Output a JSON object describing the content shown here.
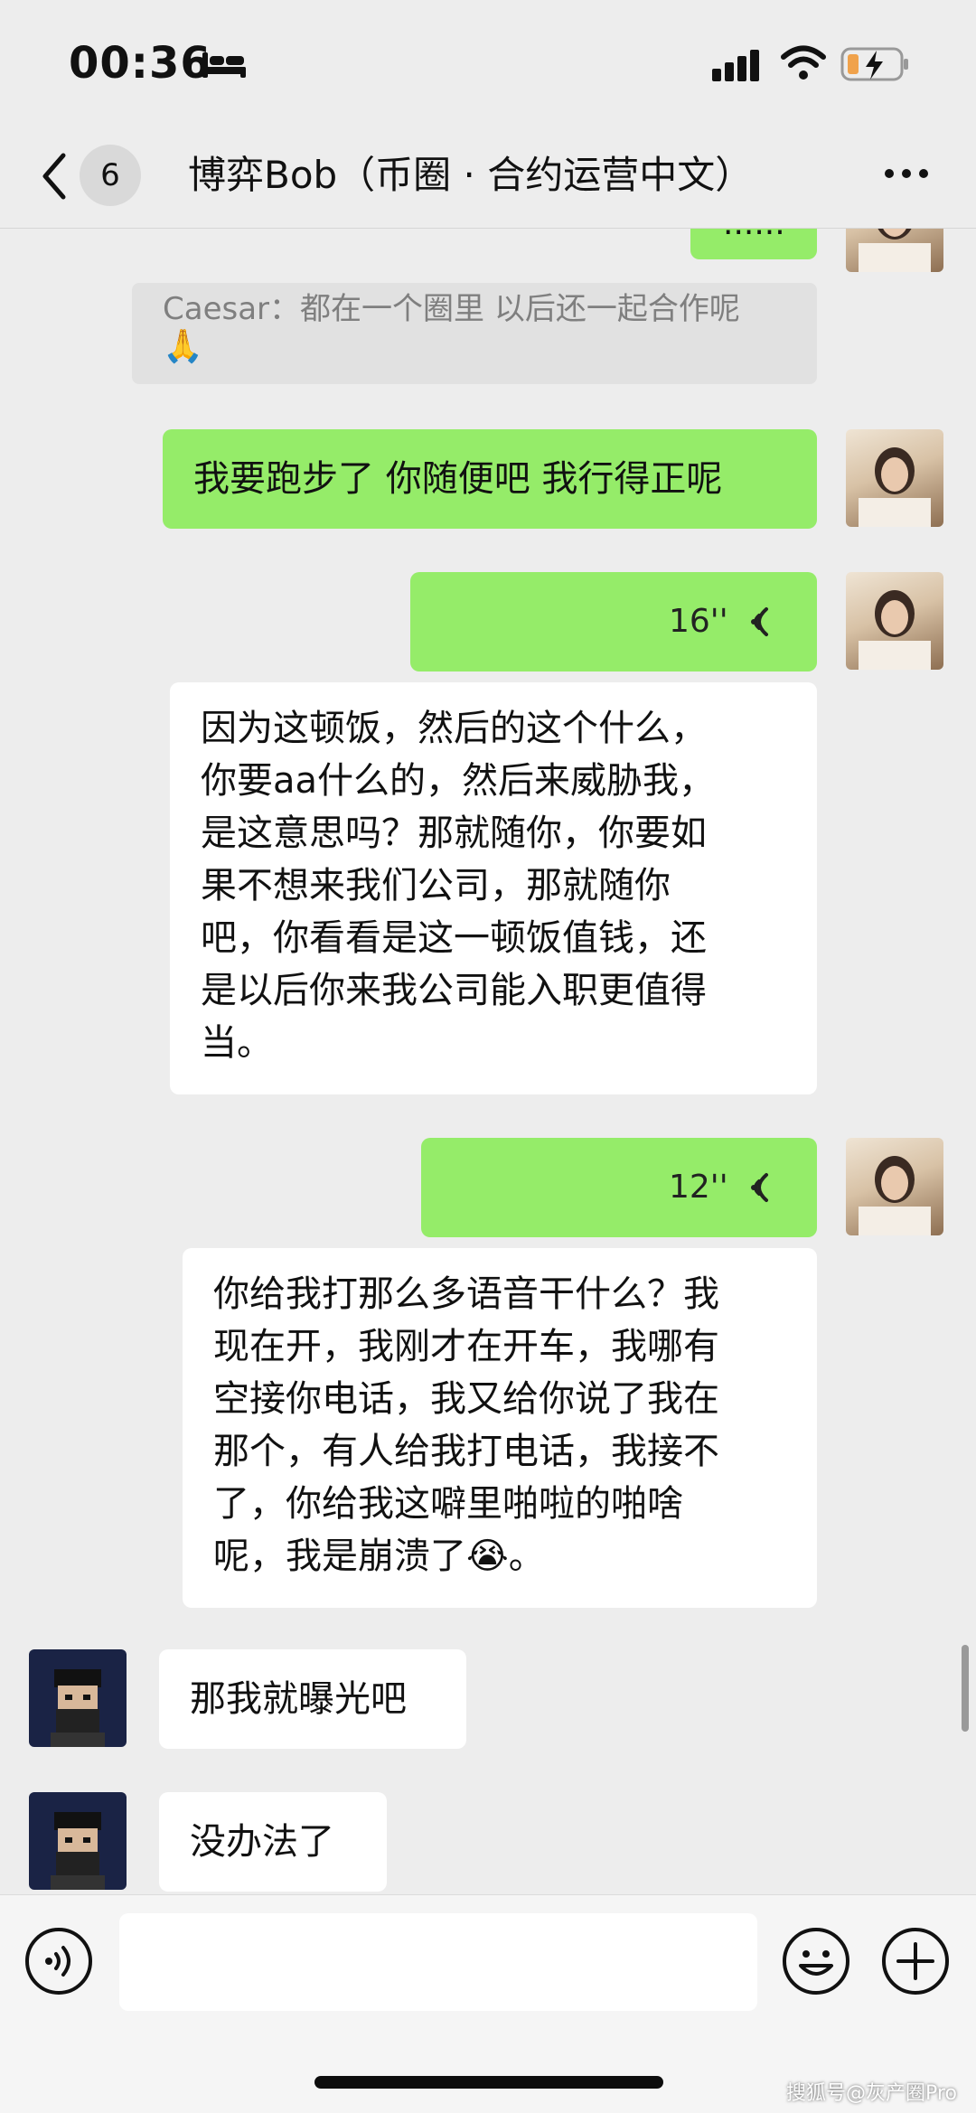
{
  "status_bar": {
    "time": "00:36",
    "sleep_icon": "bed-icon",
    "signal_icon": "cellular-signal-icon",
    "wifi_icon": "wifi-icon",
    "battery_icon": "battery-charging-icon",
    "battery_color": "#f0a24b"
  },
  "header": {
    "back_icon": "chevron-left-icon",
    "unread_count": "6",
    "title": "博弈Bob（币圈 · 合约运营中文）",
    "more_icon": "more-dots-icon"
  },
  "messages": [
    {
      "side": "right",
      "type": "text",
      "text": "......"
    },
    {
      "side": "center",
      "type": "quote",
      "text": "Caesar：都在一个圈里 以后还一起合作呢",
      "emoji": "🙏"
    },
    {
      "side": "right",
      "type": "text",
      "text": "我要跑步了 你随便吧 我行得正呢"
    },
    {
      "side": "right",
      "type": "voice",
      "duration": "16''"
    },
    {
      "side": "right",
      "type": "transcript",
      "lines": [
        "因为这顿饭，然后的这个什么，",
        "你要aa什么的，然后来威胁我，",
        "是这意思吗？那就随你，你要如",
        "果不想来我们公司，那就随你",
        "吧，你看看是这一顿饭值钱，还",
        "是以后你来我公司能入职更值得",
        "当。"
      ]
    },
    {
      "side": "right",
      "type": "voice",
      "duration": "12''"
    },
    {
      "side": "right",
      "type": "transcript",
      "lines": [
        "你给我打那么多语音干什么？我",
        "现在开，我刚才在开车，我哪有",
        "空接你电话，我又给你说了我在",
        "那个，有人给我打电话，我接不",
        "了，你给我这噼里啪啦的啪啥",
        "呢，我是崩溃了😭。"
      ]
    },
    {
      "side": "left",
      "type": "text",
      "text": "那我就曝光吧"
    },
    {
      "side": "left",
      "type": "text",
      "text": "没办法了"
    }
  ],
  "input_bar": {
    "voice_icon": "voice-input-icon",
    "input_value": "",
    "emoji_icon": "smiley-face-icon",
    "plus_icon": "plus-circle-icon"
  },
  "watermark": "搜狐号@灰产圈Pro",
  "colors": {
    "background": "#ededed",
    "bubble_green": "#95ec69",
    "bubble_white": "#ffffff",
    "quote_bg": "#e1e1e1"
  }
}
